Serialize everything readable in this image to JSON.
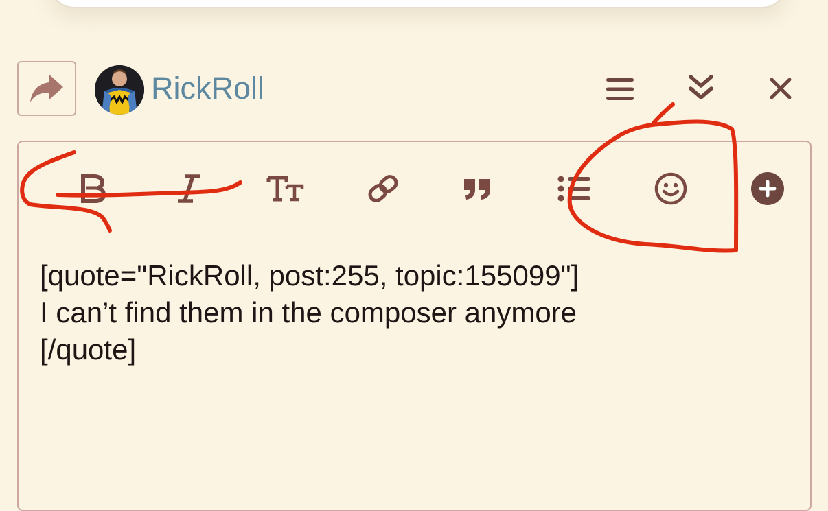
{
  "composer": {
    "username": "RickRoll",
    "reply_icon": "share-arrow-icon",
    "header_actions": [
      {
        "name": "hamburger-menu-icon"
      },
      {
        "name": "collapse-chevrons-icon"
      },
      {
        "name": "close-icon"
      }
    ]
  },
  "toolbar": {
    "buttons": [
      {
        "name": "bold-button",
        "icon": "bold-icon"
      },
      {
        "name": "italic-button",
        "icon": "italic-icon"
      },
      {
        "name": "heading-button",
        "icon": "text-size-icon"
      },
      {
        "name": "link-button",
        "icon": "link-icon"
      },
      {
        "name": "quote-button",
        "icon": "quote-icon"
      },
      {
        "name": "list-button",
        "icon": "bullet-list-icon"
      },
      {
        "name": "emoji-button",
        "icon": "smiley-icon"
      },
      {
        "name": "more-options-button",
        "icon": "plus-circle-icon"
      }
    ]
  },
  "editor": {
    "lines": [
      "[quote=\"RickRoll, post:255, topic:155099\"]",
      "I can’t find them in the composer anymore",
      "[/quote]"
    ]
  },
  "colors": {
    "background": "#fbf4e3",
    "icon": "#7a4941",
    "username": "#5d88a0",
    "border": "#cda8a2",
    "annotation": "#e02d12"
  }
}
